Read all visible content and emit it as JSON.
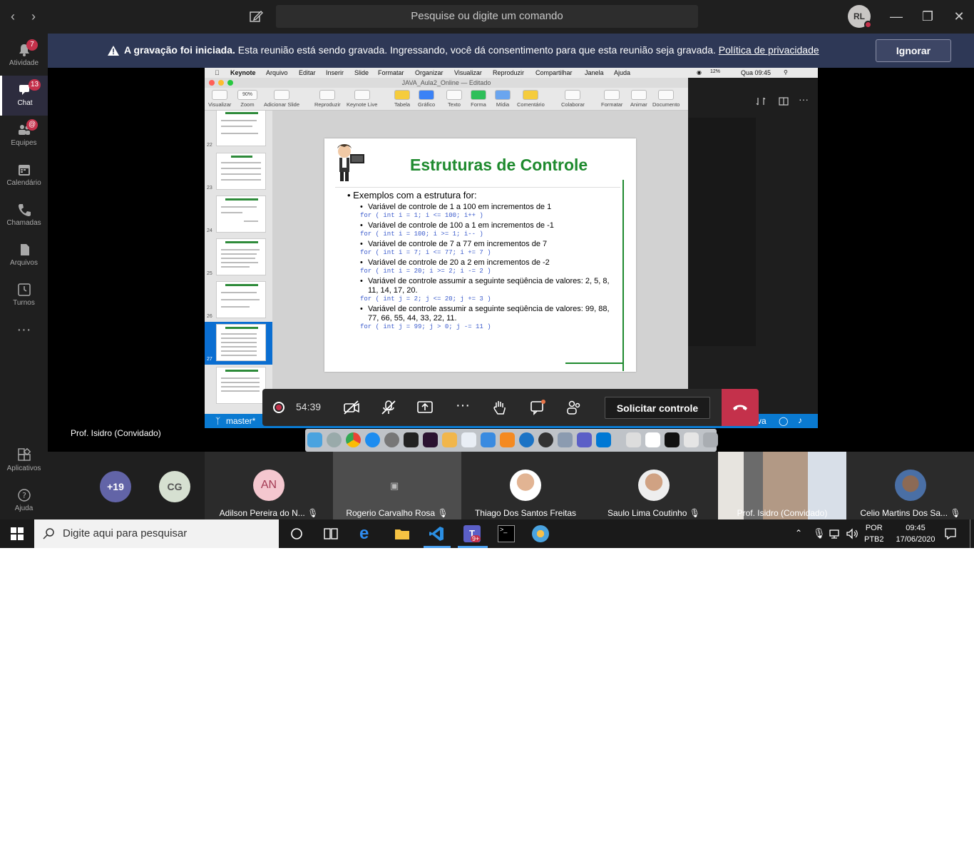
{
  "titlebar": {
    "search_placeholder": "Pesquise ou digite um comando",
    "avatar_initials": "RL"
  },
  "rail": [
    {
      "label": "Atividade",
      "badge": "7"
    },
    {
      "label": "Chat",
      "badge": "13"
    },
    {
      "label": "Equipes",
      "badge": "@"
    },
    {
      "label": "Calendário",
      "badge": ""
    },
    {
      "label": "Chamadas",
      "badge": ""
    },
    {
      "label": "Arquivos",
      "badge": ""
    },
    {
      "label": "Turnos",
      "badge": ""
    },
    {
      "label": "Aplicativos",
      "badge": ""
    },
    {
      "label": "Ajuda",
      "badge": ""
    }
  ],
  "banner": {
    "bold": "A gravação foi iniciada.",
    "text": " Esta reunião está sendo gravada. Ingressando, você dá consentimento para que esta reunião seja gravada. ",
    "link": "Política de privacidade",
    "button": "Ignorar"
  },
  "mac": {
    "menu": [
      "Keynote",
      "Arquivo",
      "Editar",
      "Inserir",
      "Slide",
      "Formatar",
      "Organizar",
      "Visualizar",
      "Reproduzir",
      "Compartilhar",
      "Janela",
      "Ajuda"
    ],
    "battery": "12%",
    "clock": "Qua 09:45"
  },
  "keynote": {
    "doc_title": "JAVA_Aula2_Online — Editado",
    "zoom": "90%",
    "toolbar": [
      "Visualizar",
      "Zoom",
      "Adicionar Slide",
      "Reproduzir",
      "Keynote Live",
      "Tabela",
      "Gráfico",
      "Texto",
      "Forma",
      "Mídia",
      "Comentário",
      "Colaborar",
      "Formatar",
      "Animar",
      "Documento"
    ],
    "thumb_numbers": [
      "22",
      "23",
      "24",
      "25",
      "26",
      "27"
    ],
    "slide": {
      "title": "Estruturas de Controle",
      "heading": "Exemplos com a estrutura for:",
      "items": [
        {
          "text": "Variável de controle de 1 a 100 em incrementos de 1",
          "code": "for ( int i = 1; i <= 100; i++ )"
        },
        {
          "text": "Variável de controle de 100 a 1 em incrementos de -1",
          "code": "for ( int i = 100; i >= 1; i-- )"
        },
        {
          "text": "Variável de controle de 7 a 77 em incrementos de 7",
          "code": "for ( int i = 7; i <= 77; i += 7 )"
        },
        {
          "text": "Variável de controle de 20 a 2 em incrementos de -2",
          "code": "for ( int i = 20; i >= 2; i -= 2 )"
        },
        {
          "text": "Variável de controle assumir a seguinte seqüência de valores: 2, 5, 8, 11, 14, 17, 20.",
          "code": "for ( int j = 2; j <= 20; j += 3 )"
        },
        {
          "text": "Variável de controle assumir a seguinte seqüência de valores: 99, 88, 77, 66, 55, 44, 33, 22, 11.",
          "code": "for ( int j = 99; j > 0; j -= 11 )"
        }
      ]
    }
  },
  "vscode_status": {
    "branch": "master*",
    "right": "va"
  },
  "call": {
    "timer": "54:39",
    "control_button": "Solicitar controle",
    "presenter": "Prof. Isidro (Convidado)"
  },
  "gallery": {
    "overflow": "+19",
    "initials_cg": "CG",
    "participants": [
      {
        "initials": "AN",
        "name": "Adilson Pereira do N..."
      },
      {
        "initials": "",
        "name": "Rogerio Carvalho Rosa"
      },
      {
        "initials": "",
        "name": "Thiago Dos Santos Freitas"
      },
      {
        "initials": "",
        "name": "Saulo Lima Coutinho"
      },
      {
        "initials": "",
        "name": "Prof. Isidro (Convidado)"
      },
      {
        "initials": "",
        "name": "Celio Martins Dos Sa..."
      }
    ]
  },
  "taskbar": {
    "search_placeholder": "Digite aqui para pesquisar",
    "lang1": "POR",
    "lang2": "PTB2",
    "time": "09:45",
    "date": "17/06/2020",
    "teams_badge": "9+"
  }
}
